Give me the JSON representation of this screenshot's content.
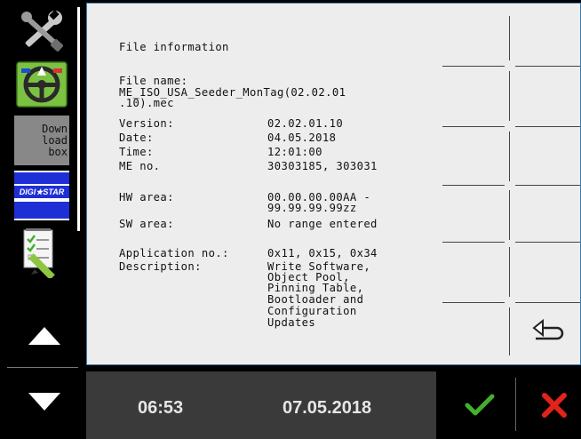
{
  "left_rail": {
    "items": [
      {
        "icon": "settings-tools-icon"
      },
      {
        "icon": "steering-wheel-icon"
      },
      {
        "icon": "download-box-icon",
        "label_lines": [
          "Down",
          "load",
          "box"
        ]
      },
      {
        "icon": "digistar-logo-icon",
        "label": "DIGI★STAR"
      },
      {
        "icon": "checklist-edit-icon"
      }
    ]
  },
  "file_info": {
    "title": "File information",
    "file_name_label": "File name:",
    "file_name_line1": "ME_ISO_USA_Seeder_MonTag(02.02.01",
    "file_name_line2": ".10).mec",
    "version_label": "Version:",
    "version_value": "02.02.01.10",
    "date_label": "Date:",
    "date_value": "04.05.2018",
    "time_label": "Time:",
    "time_value": "12:01:00",
    "me_no_label": "ME no.",
    "me_no_value": "30303185, 303031",
    "hw_area_label": "HW area:",
    "hw_area_line1": "00.00.00.00AA -",
    "hw_area_line2": "99.99.99.99zz",
    "sw_area_label": "SW area:",
    "sw_area_value": "No range entered",
    "app_no_label": "Application no.:",
    "app_no_value": "0x11, 0x15, 0x34",
    "description_label": "Description:",
    "description_lines": [
      "Write Software,",
      "Object Pool,",
      "Pinning Table,",
      "Bootloader and",
      "Configuration",
      "Updates"
    ]
  },
  "status_bar": {
    "time": "06:53",
    "date": "07.05.2018"
  },
  "colors": {
    "accept": "#43b02a",
    "cancel": "#e2231a",
    "panel": "#ededed",
    "digistar_blue": "#1f2fd6"
  }
}
